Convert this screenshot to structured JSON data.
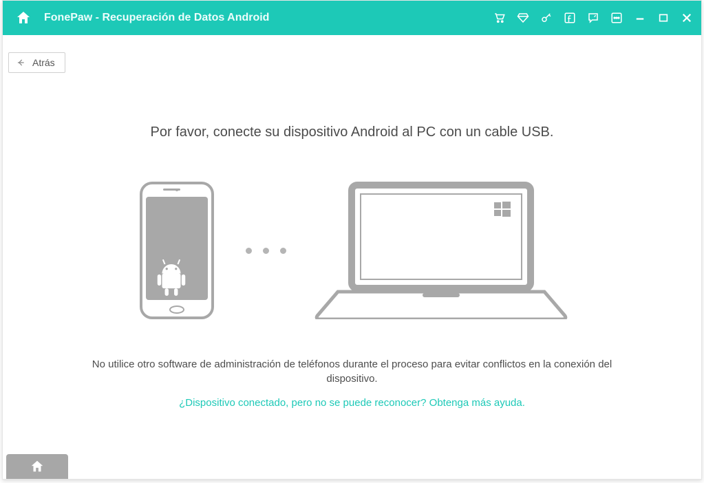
{
  "titlebar": {
    "title": "FonePaw - Recuperación de Datos Android",
    "icons": {
      "home": "home",
      "cart": "cart",
      "diamond": "diamond",
      "key": "key",
      "facebook": "facebook",
      "feedback": "feedback",
      "more": "more",
      "minimize": "minimize",
      "maximize": "maximize",
      "close": "close"
    }
  },
  "back_button": {
    "label": "Atrás"
  },
  "main": {
    "headline": "Por favor, conecte su dispositivo Android al PC con un cable USB.",
    "note": "No utilice otro software de administración de teléfonos durante el proceso para evitar conflictos en la conexión del dispositivo.",
    "help_link": "¿Dispositivo conectado, pero no se puede reconocer? Obtenga más ayuda."
  },
  "colors": {
    "accent": "#1dc9b7",
    "gray": "#a8a8a8"
  }
}
